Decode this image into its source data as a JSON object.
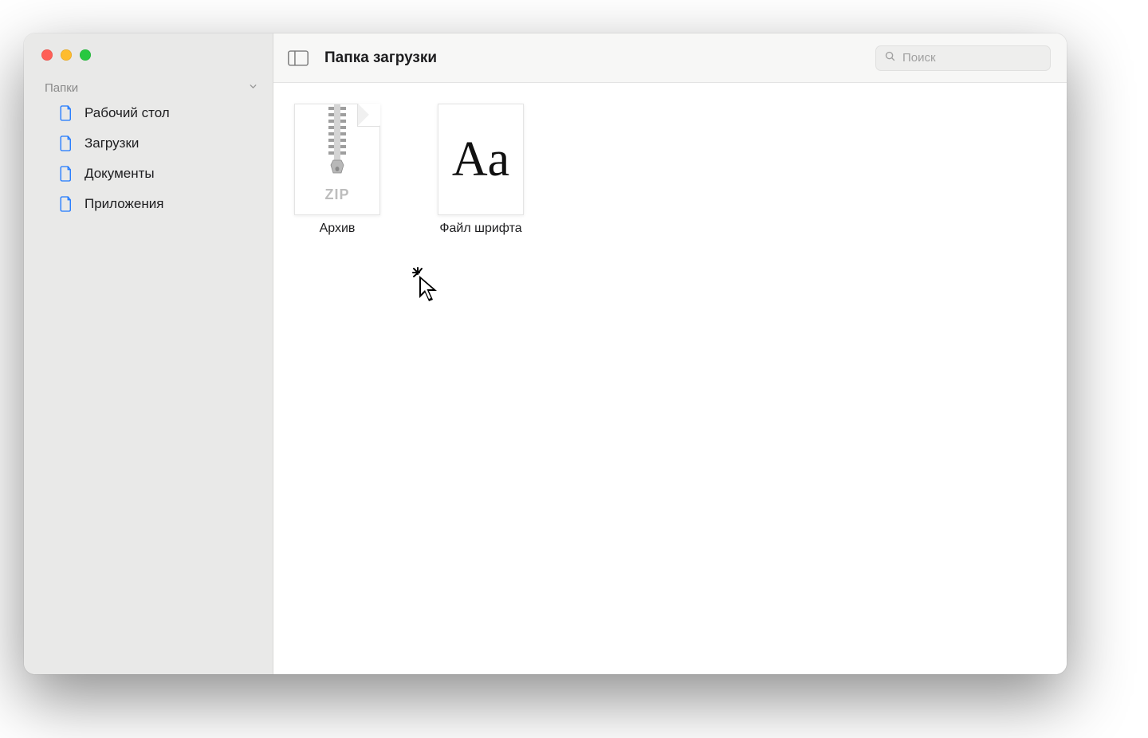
{
  "window_title": "Папка загрузки",
  "search": {
    "placeholder": "Поиск"
  },
  "sidebar": {
    "group_label": "Папки",
    "items": [
      {
        "label": "Рабочий стол"
      },
      {
        "label": "Загрузки"
      },
      {
        "label": "Документы"
      },
      {
        "label": "Приложения"
      }
    ]
  },
  "files": [
    {
      "kind": "zip",
      "label": "Архив",
      "badge": "ZIP"
    },
    {
      "kind": "font",
      "label": "Файл шрифта",
      "glyph": "Aa"
    }
  ]
}
